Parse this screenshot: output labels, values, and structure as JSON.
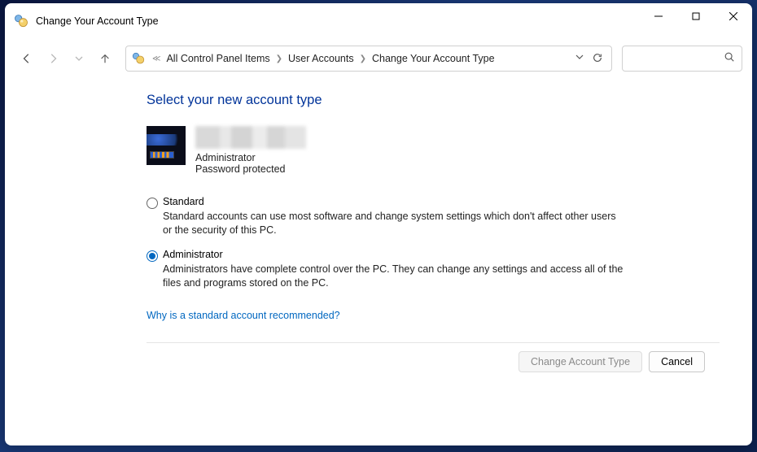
{
  "window": {
    "title": "Change Your Account Type"
  },
  "breadcrumb": {
    "item0": "All Control Panel Items",
    "item1": "User Accounts",
    "item2": "Change Your Account Type"
  },
  "page": {
    "heading": "Select your new account type",
    "user_role": "Administrator",
    "user_protection": "Password protected"
  },
  "options": {
    "standard": {
      "label": "Standard",
      "desc": "Standard accounts can use most software and change system settings which don't affect other users or the security of this PC."
    },
    "admin": {
      "label": "Administrator",
      "desc": "Administrators have complete control over the PC. They can change any settings and access all of the files and programs stored on the PC."
    }
  },
  "link": "Why is a standard account recommended?",
  "buttons": {
    "change": "Change Account Type",
    "cancel": "Cancel"
  }
}
